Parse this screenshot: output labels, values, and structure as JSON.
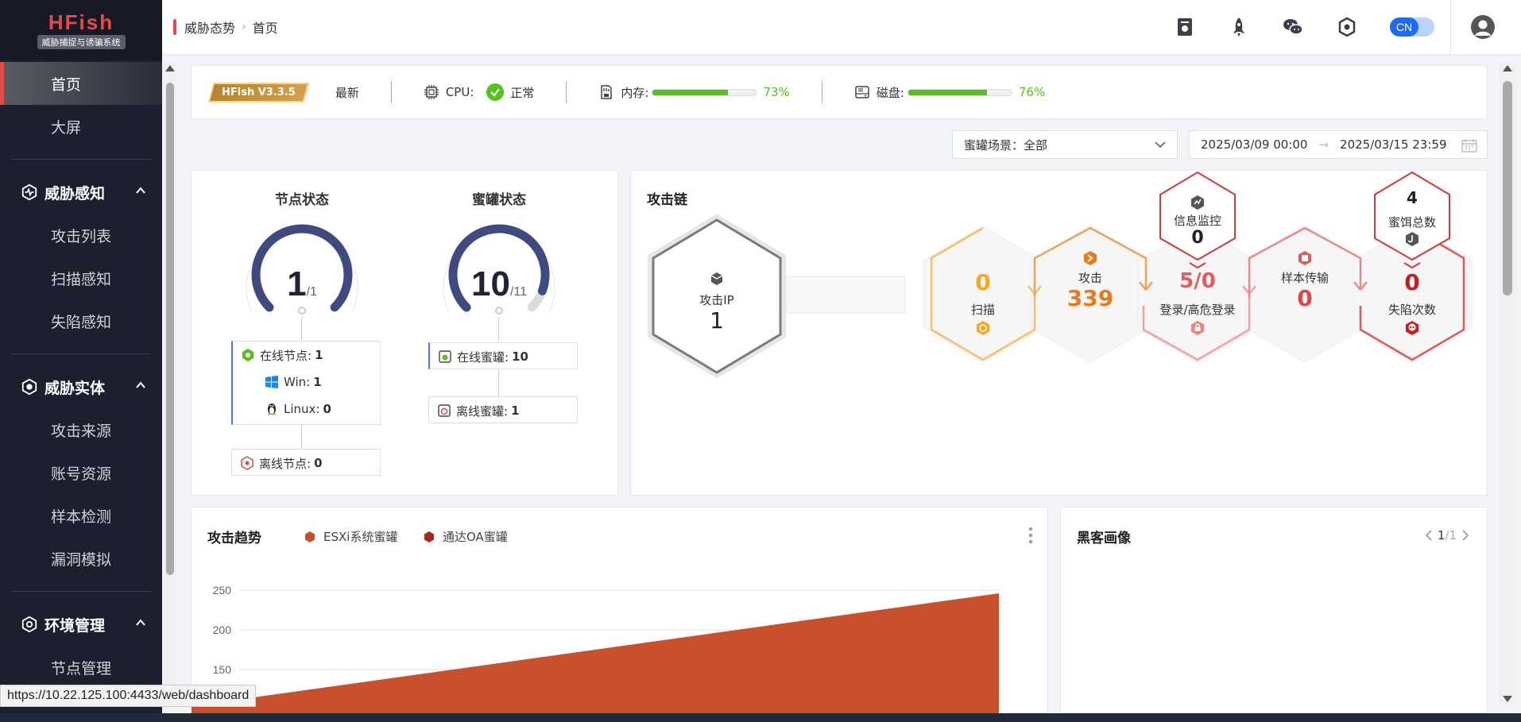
{
  "app": {
    "logo_title": "HFish",
    "logo_subtitle": "威胁捕捉与诱骗系统"
  },
  "sidebar": {
    "top_items": [
      {
        "label": "首页",
        "active": true
      },
      {
        "label": "大屏"
      }
    ],
    "groups": [
      {
        "label": "威胁感知",
        "icon": "pulse-icon",
        "items": [
          "攻击列表",
          "扫描感知",
          "失陷感知"
        ]
      },
      {
        "label": "威胁实体",
        "icon": "hexagon-target-icon",
        "items": [
          "攻击来源",
          "账号资源",
          "样本检测",
          "漏洞模拟"
        ]
      },
      {
        "label": "环境管理",
        "icon": "hexagon-gear-icon",
        "items": [
          "节点管理"
        ]
      }
    ]
  },
  "header": {
    "breadcrumb": [
      "威胁态势",
      "首页"
    ],
    "icons": [
      "document-icon",
      "rocket-icon",
      "wechat-icon",
      "hexagon-icon"
    ],
    "lang": "CN"
  },
  "infobar": {
    "version": "HFish V3.3.5",
    "latest": "最新",
    "cpu_label": "CPU:",
    "cpu_status": "正常",
    "mem_label": "内存:",
    "mem_pct": "73%",
    "mem_value": 0.73,
    "disk_label": "磁盘:",
    "disk_pct": "76%",
    "disk_value": 0.76
  },
  "filters": {
    "scene_label": "蜜罐场景：全部",
    "date_start": "2025/03/09 00:00",
    "date_sep": "→",
    "date_end": "2025/03/15 23:59"
  },
  "status": {
    "node_title": "节点状态",
    "node_value": "1",
    "node_total": "/1",
    "node_fraction": 1.0,
    "honeypot_title": "蜜罐状态",
    "honeypot_value": "10",
    "honeypot_total": "/11",
    "honeypot_fraction": 0.909,
    "online_nodes_label": "在线节点:",
    "online_nodes": "1",
    "win_label": "Win:",
    "win": "1",
    "linux_label": "Linux:",
    "linux": "0",
    "offline_nodes_label": "离线节点:",
    "offline_nodes": "0",
    "online_hp_label": "在线蜜罐:",
    "online_hp": "10",
    "offline_hp_label": "离线蜜罐:",
    "offline_hp": "1"
  },
  "chain": {
    "title": "攻击链",
    "attack_ip_label": "攻击IP",
    "attack_ip": "1",
    "scan_value": "0",
    "scan_label": "扫描",
    "attack_label": "攻击",
    "attack_value": "339",
    "login_value": "5/0",
    "login_label": "登录/高危登录",
    "sample_label": "样本传输",
    "sample_value": "0",
    "fall_value": "0",
    "fall_label": "失陷次数",
    "monitor_label": "信息监控",
    "monitor_value": "0",
    "bait_value": "4",
    "bait_label": "蜜饵总数"
  },
  "trend": {
    "title": "攻击趋势",
    "more_icon": "kebab-icon"
  },
  "chart_data": {
    "type": "area",
    "series": [
      {
        "name": "ESXi系统蜜罐",
        "color": "#c8502d"
      },
      {
        "name": "通达OA蜜罐",
        "color": "#a8261f"
      }
    ],
    "yticks": [
      "250",
      "200",
      "150"
    ]
  },
  "hacker": {
    "title": "黑客画像",
    "page": "1",
    "total": "/1"
  },
  "statusbar": {
    "url": "https://10.22.125.100:4433/web/dashboard"
  },
  "colors": {
    "accent": "#e84a4a",
    "sidebar_bg": "#1b1f2e",
    "ok_green": "#52c41a",
    "gauge_blue": "#3f4b80",
    "scan_orange": "#f5a623",
    "attack_orange": "#e87a1c",
    "danger_red": "#e04545"
  }
}
